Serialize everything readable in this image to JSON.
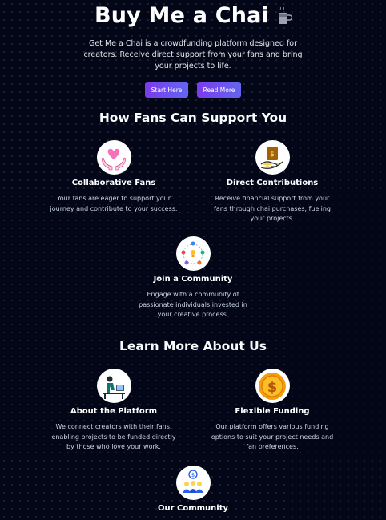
{
  "hero": {
    "title": "Buy Me a Chai",
    "chai_icon": "chai-cup-icon",
    "description": "Get Me a Chai is a crowdfunding platform designed for creators. Receive direct support from your fans and bring your projects to life.",
    "start_label": "Start Here",
    "read_label": "Read More"
  },
  "support": {
    "title": "How Fans Can Support You",
    "items": [
      {
        "icon": "heart-hands-icon",
        "title": "Collaborative Fans",
        "text": "Your fans are eager to support your journey and contribute to your success."
      },
      {
        "icon": "money-hand-icon",
        "title": "Direct Contributions",
        "text": "Receive financial support from your fans through chai purchases, fueling your projects."
      },
      {
        "icon": "community-network-icon",
        "title": "Join a Community",
        "text": "Engage with a community of passionate individuals invested in your creative process."
      }
    ]
  },
  "learn": {
    "title": "Learn More About Us",
    "items": [
      {
        "icon": "person-at-desk-icon",
        "title": "About the Platform",
        "text": "We connect creators with their fans, enabling projects to be funded directly by those who love your work."
      },
      {
        "icon": "dollar-coin-icon",
        "title": "Flexible Funding",
        "text": "Our platform offers various funding options to suit your project needs and fan preferences."
      },
      {
        "icon": "community-group-icon",
        "title": "Our Community",
        "text": ""
      }
    ]
  },
  "colors": {
    "background": "#020617",
    "button_start": "#7c3aed",
    "button_end": "#6366f1"
  }
}
